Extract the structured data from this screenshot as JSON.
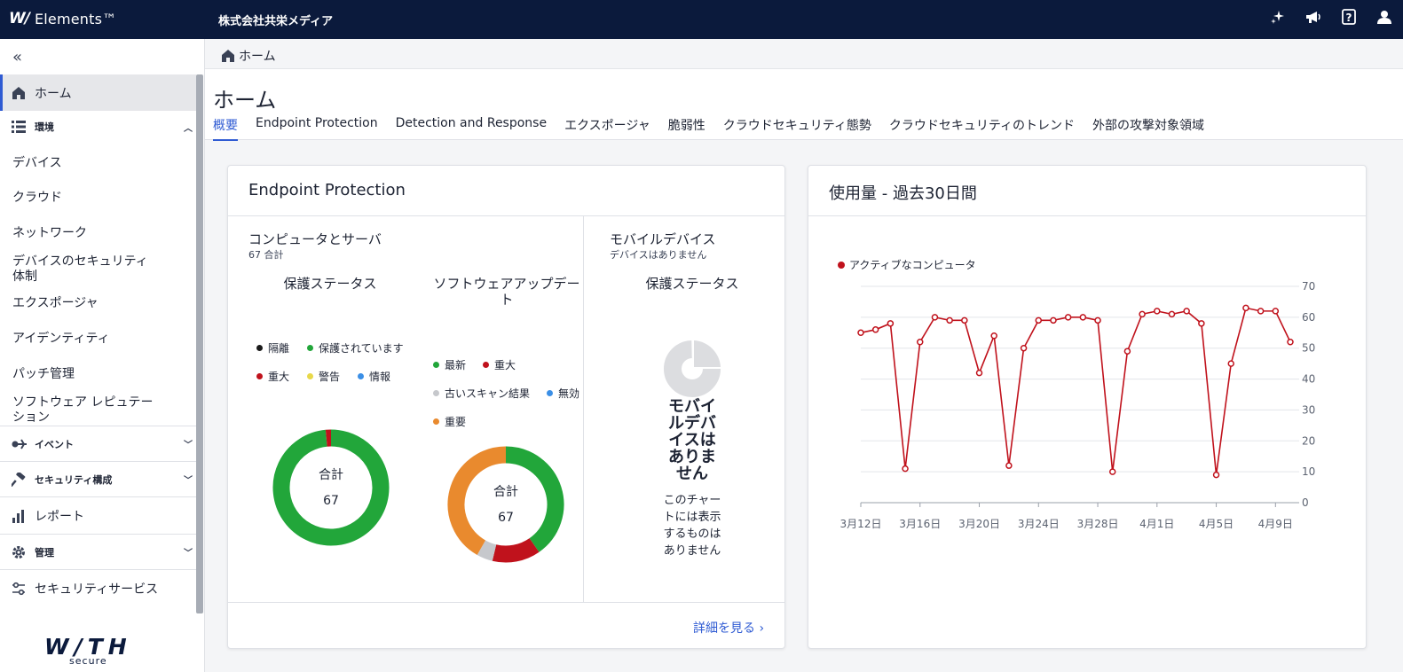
{
  "topbar": {
    "logo_mark": "W/",
    "logo_text": "Elements™",
    "company": "株式会社共栄メディア",
    "icons": [
      "sparkle-icon",
      "megaphone-icon",
      "help-icon",
      "user-icon"
    ]
  },
  "sidebar": {
    "home": "ホーム",
    "section_env": "環境",
    "env_items": [
      "デバイス",
      "クラウド",
      "ネットワーク",
      "デバイスのセキュリティ体制",
      "エクスポージャ",
      "アイデンティティ",
      "パッチ管理",
      "ソフトウェア レピュテーション"
    ],
    "section_events": "イベント",
    "section_security": "セキュリティ構成",
    "reports": "レポート",
    "section_admin": "管理",
    "security_services": "セキュリティサービス",
    "brand_top": "W/TH",
    "brand_bottom": "secure"
  },
  "breadcrumb": {
    "home": "ホーム"
  },
  "page": {
    "title": "ホーム",
    "tabs": [
      "概要",
      "Endpoint Protection",
      "Detection and Response",
      "エクスポージャ",
      "脆弱性",
      "クラウドセキュリティ態勢",
      "クラウドセキュリティのトレンド",
      "外部の攻撃対象領域"
    ],
    "active_tab": 0
  },
  "endpoint_card": {
    "title": "Endpoint Protection",
    "computers_title": "コンピュータとサーバ",
    "computers_count": "67 合計",
    "protection_title": "保護ステータス",
    "protection_legend": [
      {
        "label": "隔離",
        "color": "#1a1a1a"
      },
      {
        "label": "保護されています",
        "color": "#22a63a"
      },
      {
        "label": "重大",
        "color": "#c0121c"
      },
      {
        "label": "警告",
        "color": "#e8d84a"
      },
      {
        "label": "情報",
        "color": "#3b8fe6"
      }
    ],
    "protection_total_label": "合計",
    "protection_total": "67",
    "software_title": "ソフトウェアアップデート",
    "software_legend": [
      {
        "label": "最新",
        "color": "#22a63a"
      },
      {
        "label": "重大",
        "color": "#c0121c"
      },
      {
        "label": "古いスキャン結果",
        "color": "#c6c8cc"
      },
      {
        "label": "無効",
        "color": "#3b8fe6"
      },
      {
        "label": "重要",
        "color": "#e98a2e"
      }
    ],
    "software_total_label": "合計",
    "software_total": "67",
    "mobile_title": "モバイルデバイス",
    "mobile_sub": "デバイスはありません",
    "mobile_protection_title": "保護ステータス",
    "mobile_none": "モバイルデバイスはありません",
    "mobile_none_sub": "このチャートには表示するものはありません",
    "more_link": "詳細を見る ›"
  },
  "donut_protection": [
    {
      "label": "保護されています",
      "value": 66,
      "color": "#22a63a"
    },
    {
      "label": "重大",
      "value": 1,
      "color": "#c0121c"
    }
  ],
  "donut_software": [
    {
      "label": "最新",
      "value": 27,
      "color": "#22a63a"
    },
    {
      "label": "重大",
      "value": 9,
      "color": "#c0121c"
    },
    {
      "label": "古いスキャン結果",
      "value": 3,
      "color": "#c6c8cc"
    },
    {
      "label": "重要",
      "value": 28,
      "color": "#e98a2e"
    }
  ],
  "usage_card": {
    "title": "使用量 - 過去30日間"
  },
  "chart_data": {
    "type": "line",
    "series": [
      {
        "name": "アクティブなコンピュータ",
        "color": "#c0121c",
        "values": [
          55,
          56,
          58,
          11,
          52,
          60,
          59,
          59,
          42,
          54,
          12,
          50,
          59,
          59,
          60,
          60,
          59,
          10,
          49,
          61,
          62,
          61,
          62,
          58,
          9,
          45,
          63,
          62,
          62,
          52
        ]
      }
    ],
    "x_tick_labels": [
      "3月12日",
      "3月16日",
      "3月20日",
      "3月24日",
      "3月28日",
      "4月1日",
      "4月5日",
      "4月9日"
    ],
    "x_tick_every": 4,
    "ylim": [
      0,
      70
    ],
    "yticks": [
      0,
      10,
      20,
      30,
      40,
      50,
      60,
      70
    ],
    "y_axis_side": "right",
    "grid": true,
    "legend": "top-left"
  }
}
